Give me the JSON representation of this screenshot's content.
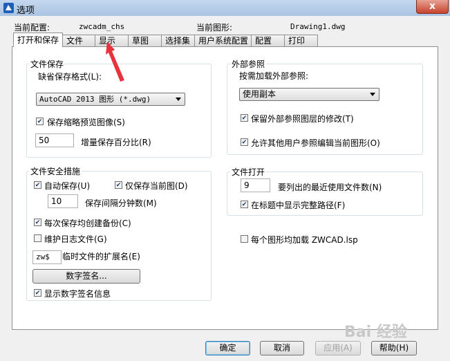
{
  "window": {
    "title": "选项",
    "close_label": "x"
  },
  "header": {
    "profile_label": "当前配置:",
    "profile_value": "zwcadm_chs",
    "drawing_label": "当前图形:",
    "drawing_value": "Drawing1.dwg"
  },
  "tabs": [
    {
      "label": "打开和保存",
      "active": true
    },
    {
      "label": "文件"
    },
    {
      "label": "显示"
    },
    {
      "label": "草图"
    },
    {
      "label": "选择集"
    },
    {
      "label": "用户系统配置"
    },
    {
      "label": "配置"
    },
    {
      "label": "打印"
    }
  ],
  "file_save": {
    "title": "文件保存",
    "format_label": "缺省保存格式(L):",
    "format_value": "AutoCAD 2013 图形 (*.dwg)",
    "thumbnail_label": "保存缩略预览图像(S)",
    "thumbnail_checked": true,
    "incremental_value": "50",
    "incremental_label": "增量保存百分比(R)"
  },
  "file_safety": {
    "title": "文件安全措施",
    "autosave_label": "自动保存(U)",
    "autosave_checked": true,
    "current_only_label": "仅保存当前图(D)",
    "current_only_checked": true,
    "interval_value": "10",
    "interval_label": "保存间隔分钟数(M)",
    "backup_label": "每次保存均创建备份(C)",
    "backup_checked": true,
    "log_label": "维护日志文件(G)",
    "log_checked": false,
    "temp_ext_value": "zw$",
    "temp_ext_label": "临时文件的扩展名(E)",
    "signature_button": "数字签名...",
    "show_signature_label": "显示数字签名信息",
    "show_signature_checked": true
  },
  "xref": {
    "title": "外部参照",
    "demand_label": "按需加载外部参照:",
    "demand_value": "使用副本",
    "retain_label": "保留外部参照图层的修改(T)",
    "retain_checked": true,
    "allow_label": "允许其他用户参照编辑当前图形(O)",
    "allow_checked": true
  },
  "file_open": {
    "title": "文件打开",
    "recent_value": "9",
    "recent_label": "要列出的最近使用文件数(N)",
    "fullpath_label": "在标题中显示完整路径(F)",
    "fullpath_checked": true
  },
  "lsp": {
    "label": "每个图形均加载 ZWCAD.lsp",
    "checked": false
  },
  "buttons": {
    "ok": "确定",
    "cancel": "取消",
    "apply": "应用(A)",
    "help": "帮助(H)"
  },
  "watermark": "Bai 经验",
  "colors": {
    "annotation_arrow": "#e8323c",
    "title_bar": "#b5cce8",
    "default_button_border": "#3c7fb1"
  }
}
